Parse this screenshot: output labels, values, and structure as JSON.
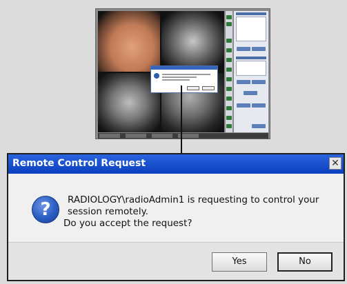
{
  "dialog": {
    "title": "Remote Control Request",
    "message_line1": "RADIOLOGY\\radioAdmin1 is requesting to control your session remotely.",
    "message_line2": "Do you accept the request?",
    "buttons": {
      "yes": "Yes",
      "no": "No"
    },
    "icons": {
      "close": "close-icon",
      "question": "question-icon"
    }
  },
  "colors": {
    "titlebar": "#0b46c9",
    "accent_green": "#2d7a3a",
    "panel_blue": "#5d7fb8"
  }
}
